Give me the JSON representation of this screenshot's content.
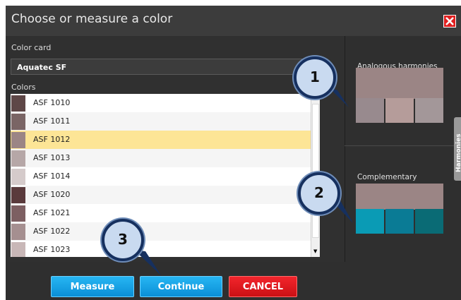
{
  "dialog": {
    "title": "Choose or measure a color",
    "close_icon": "close-icon"
  },
  "left": {
    "color_card_label": "Color card",
    "color_card_value": "Aquatec SF",
    "colors_label": "Colors",
    "items": [
      {
        "label": "ASF 1010",
        "swatch": "#5e4747",
        "selected": false
      },
      {
        "label": "ASF 1011",
        "swatch": "#7a6565",
        "selected": false
      },
      {
        "label": "ASF 1012",
        "swatch": "#9b8585",
        "selected": true
      },
      {
        "label": "ASF 1013",
        "swatch": "#b6a7a7",
        "selected": false
      },
      {
        "label": "ASF 1014",
        "swatch": "#d5cbcb",
        "selected": false
      },
      {
        "label": "ASF 1020",
        "swatch": "#5a3a3c",
        "selected": false
      },
      {
        "label": "ASF 1021",
        "swatch": "#7d5f62",
        "selected": false
      },
      {
        "label": "ASF 1022",
        "swatch": "#a58f90",
        "selected": false
      },
      {
        "label": "ASF 1023",
        "swatch": "#c8b7b7",
        "selected": false
      }
    ]
  },
  "right": {
    "analogous_label": "Analogous harmonies",
    "analogous_main": "#9b8585",
    "analogous_swatches": [
      "#988a8e",
      "#b59c9a",
      "#a39799"
    ],
    "complementary_label": "Complementary",
    "complementary_main": "#9b8585",
    "complementary_swatches": [
      "#0a9bb5",
      "#0a7b95",
      "#0a6b75"
    ],
    "side_tab": "Harmonies"
  },
  "buttons": {
    "measure": "Measure",
    "continue": "Continue",
    "cancel": "CANCEL"
  },
  "callouts": [
    "1",
    "2",
    "3"
  ],
  "colors": {
    "dialog_bg": "#2f2f2f",
    "titlebar_bg": "#3c3c3c",
    "selected_row": "#fde596",
    "button_blue": "#1aa3e8",
    "button_red": "#e0191f",
    "callout_fill": "#c9daf0",
    "callout_border": "#16305f"
  }
}
